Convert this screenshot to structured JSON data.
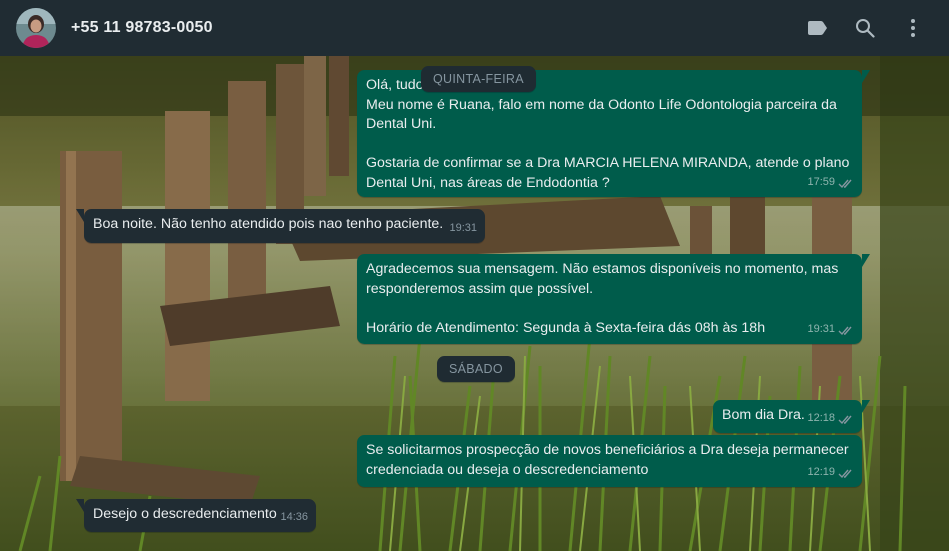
{
  "header": {
    "contact_name": "+55 11 98783-0050",
    "icons": [
      "label-icon",
      "search-icon",
      "menu-icon"
    ]
  },
  "day_chips": {
    "thursday": "QUINTA-FEIRA",
    "saturday": "SÁBADO"
  },
  "messages": [
    {
      "direction": "out",
      "text": "Olá, tudo bem?\nMeu nome é Ruana, falo em nome da Odonto Life Odontologia parceira da Dental Uni.\n\nGostaria de confirmar se a Dra MARCIA HELENA MIRANDA, atende o plano Dental Uni, nas áreas de Endodontia ?",
      "time": "17:59",
      "status": "read"
    },
    {
      "direction": "in",
      "text": "Boa noite. Não tenho atendido pois nao tenho paciente.",
      "time": "19:31"
    },
    {
      "direction": "out",
      "text": "Agradecemos sua mensagem. Não estamos disponíveis no momento, mas responderemos assim que possível.\n\nHorário de Atendimento: Segunda à Sexta-feira dás 08h às 18h",
      "time": "19:31",
      "status": "read"
    },
    {
      "direction": "out",
      "text": "Bom dia Dra.",
      "time": "12:18",
      "status": "read"
    },
    {
      "direction": "out",
      "text": "Se solicitarmos prospecção de novos beneficiários a Dra deseja permanecer credenciada ou deseja o descredenciamento",
      "time": "12:19",
      "status": "read"
    },
    {
      "direction": "in",
      "text": "Desejo o descredenciamento",
      "time": "14:36"
    }
  ],
  "colors": {
    "header_bg": "#202c33",
    "outgoing_bubble": "#005c4b",
    "incoming_bubble": "#202c33",
    "read_tick": "#8696a0"
  }
}
